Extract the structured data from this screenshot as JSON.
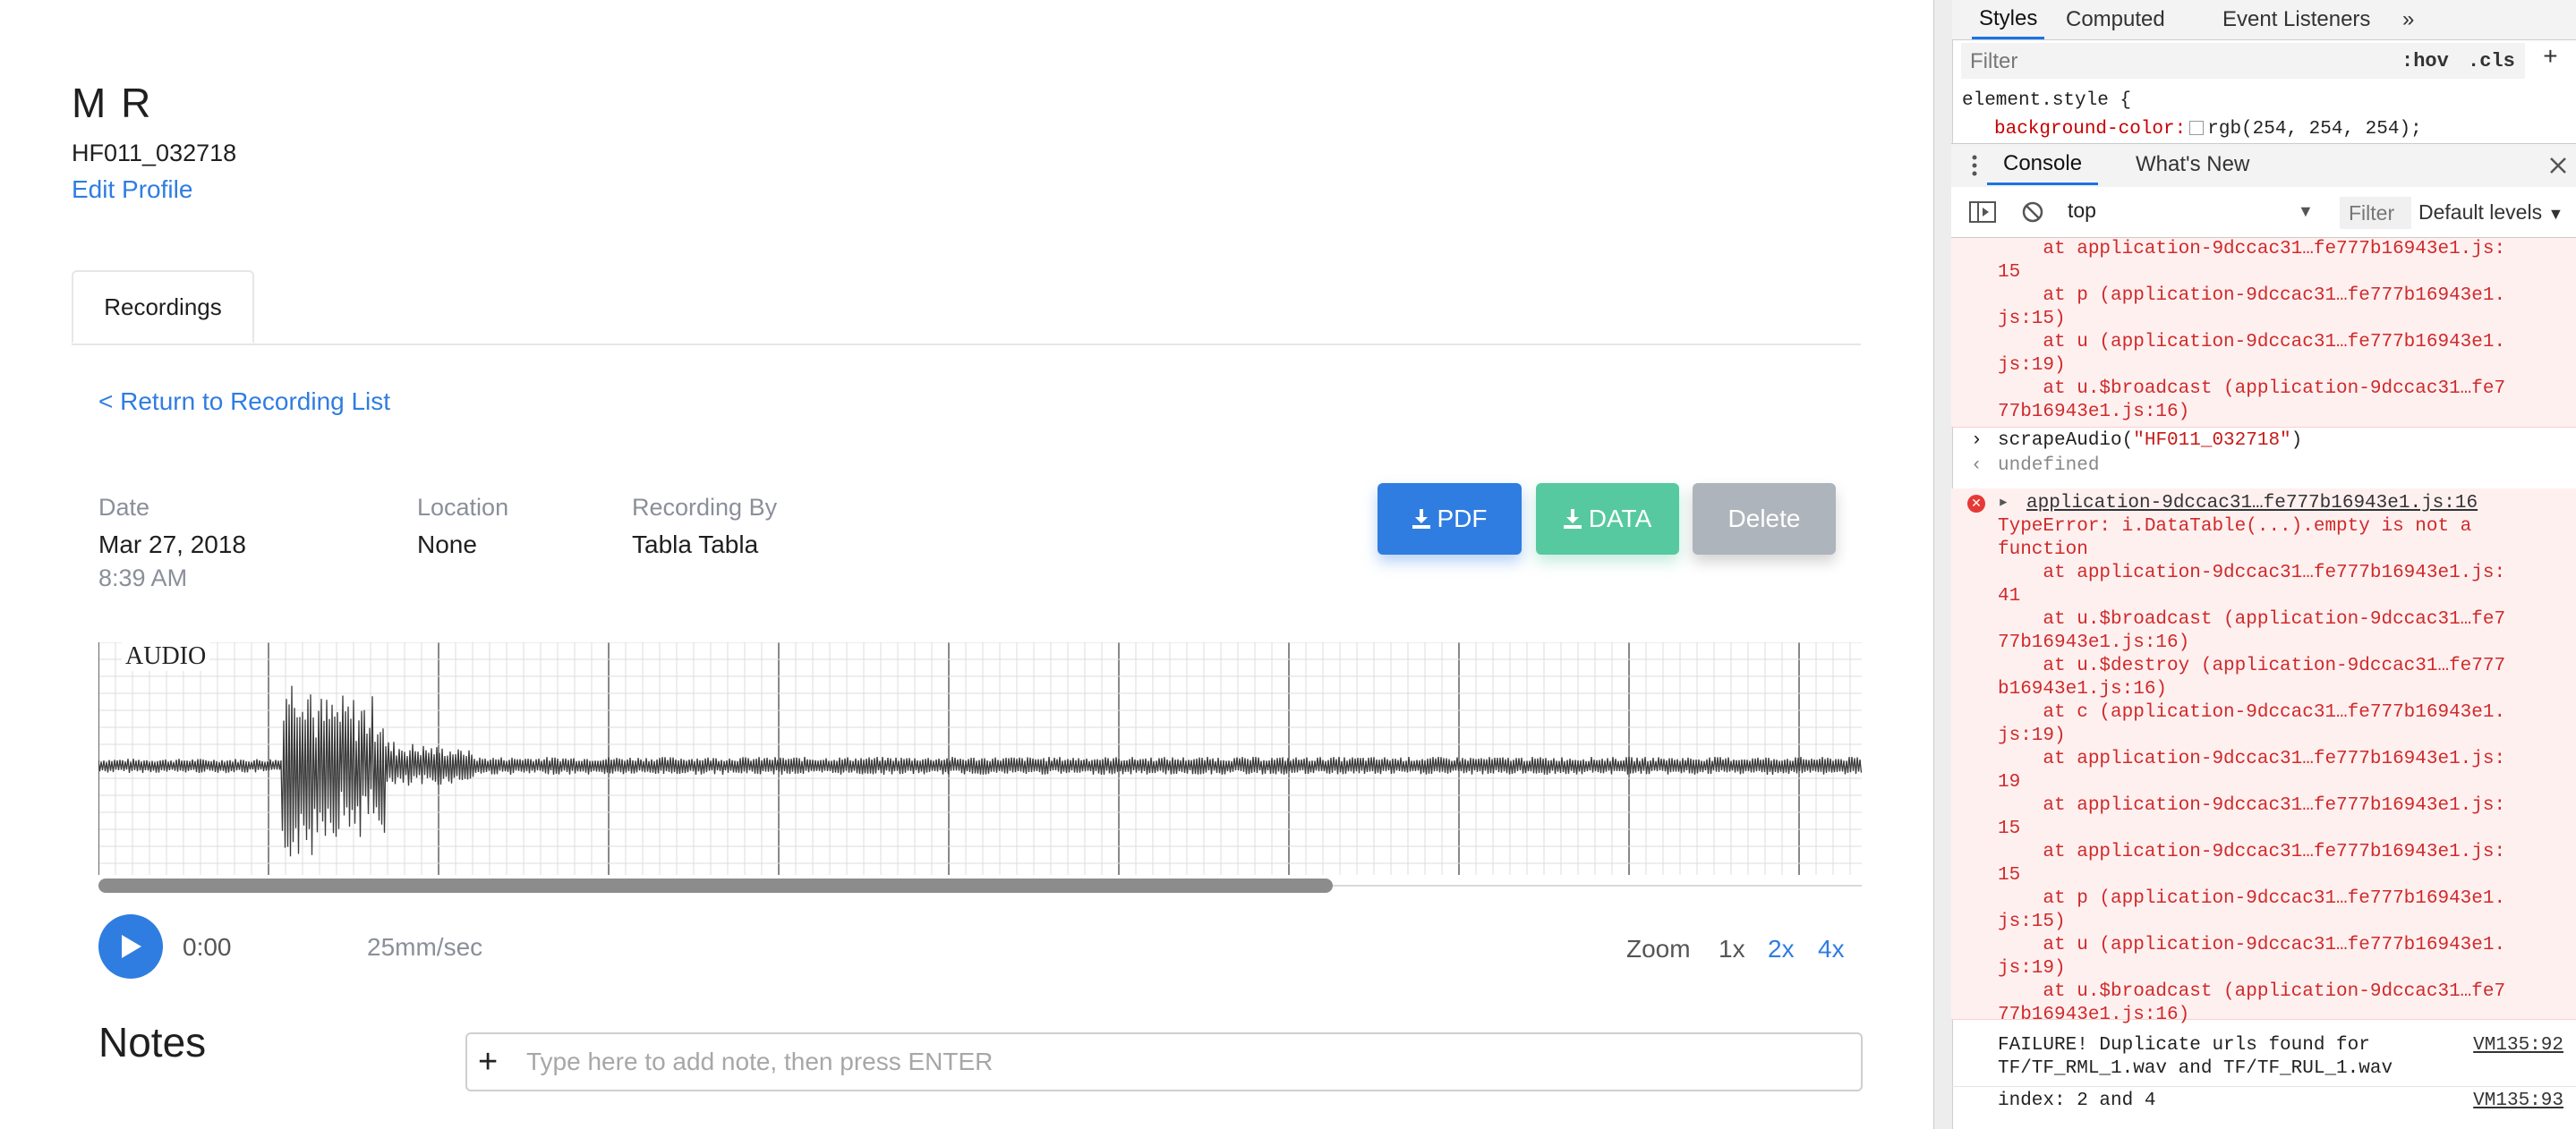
{
  "profile": {
    "name": "M R",
    "id": "HF011_032718",
    "edit_label": "Edit Profile"
  },
  "tabs": [
    {
      "label": "Recordings"
    }
  ],
  "recording": {
    "return_label": "< Return to Recording List",
    "date_label": "Date",
    "date_value": "Mar 27, 2018",
    "time_value": "8:39 AM",
    "location_label": "Location",
    "location_value": "None",
    "by_label": "Recording By",
    "by_value": "Tabla Tabla",
    "buttons": {
      "pdf": "PDF",
      "data": "DATA",
      "delete": "Delete"
    },
    "audio_label": "AUDIO",
    "playback": {
      "time": "0:00",
      "speed": "25mm/sec"
    },
    "zoom": {
      "label": "Zoom",
      "options": [
        "1x",
        "2x",
        "4x"
      ],
      "selected": "1x"
    },
    "notes_title": "Notes",
    "note_placeholder": "Type here to add note, then press ENTER",
    "scroll_position_fraction": 0.7
  },
  "colors": {
    "primary": "#2f7de1",
    "data_btn": "#57c9a1",
    "delete_btn": "#aeb4bb",
    "console_error_bg": "#fff0f0",
    "console_error_text": "#cf2a2a"
  },
  "devtools": {
    "tabs": [
      "Styles",
      "Computed",
      "Event Listeners",
      "»"
    ],
    "filter_placeholder": "Filter",
    "hov": ":hov",
    "cls": ".cls",
    "plus": "+",
    "style_rule_line1": "element.style {",
    "style_rule_prop": "background-color:",
    "style_rule_value": "rgb(254, 254, 254);",
    "console_tabs": [
      "Console",
      "What's New"
    ],
    "context": "top",
    "console_filter": "Filter",
    "levels": "Default levels",
    "lines": {
      "b1_l1": "    at application-9dccac31…fe777b16943e1.js:",
      "b1_l2": "15",
      "b1_l3": "    at p (application-9dccac31…fe777b16943e1.",
      "b1_l4": "js:15)",
      "b1_l5": "    at u (application-9dccac31…fe777b16943e1.",
      "b1_l6": "js:19)",
      "b1_l7": "    at u.$broadcast (application-9dccac31…fe7",
      "b1_l8": "77b16943e1.js:16)",
      "cmd_fn": "scrapeAudio(",
      "cmd_arg": "\"HF011_032718\"",
      "cmd_end": ")",
      "result": "undefined",
      "e_head": "application-9dccac31…fe777b16943e1.js:16",
      "e_msg1": "TypeError: i.DataTable(...).empty is not a",
      "e_msg2": "function",
      "e_1": "    at application-9dccac31…fe777b16943e1.js:",
      "e_2": "41",
      "e_3": "    at u.$broadcast (application-9dccac31…fe7",
      "e_4": "77b16943e1.js:16)",
      "e_5": "    at u.$destroy (application-9dccac31…fe777",
      "e_6": "b16943e1.js:16)",
      "e_7": "    at c (application-9dccac31…fe777b16943e1.",
      "e_8": "js:19)",
      "e_9": "    at application-9dccac31…fe777b16943e1.js:",
      "e_10": "19",
      "e_11": "    at application-9dccac31…fe777b16943e1.js:",
      "e_12": "15",
      "e_13": "    at application-9dccac31…fe777b16943e1.js:",
      "e_14": "15",
      "e_15": "    at p (application-9dccac31…fe777b16943e1.",
      "e_16": "js:15)",
      "e_17": "    at u (application-9dccac31…fe777b16943e1.",
      "e_18": "js:19)",
      "e_19": "    at u.$broadcast (application-9dccac31…fe7",
      "e_20": "77b16943e1.js:16)",
      "f1": "FAILURE! Duplicate urls found for",
      "f2": "TF/TF_RML_1.wav and TF/TF_RUL_1.wav",
      "f_src": "VM135:92",
      "idx": "index: 2 and 4",
      "idx_src": "VM135:93"
    }
  }
}
